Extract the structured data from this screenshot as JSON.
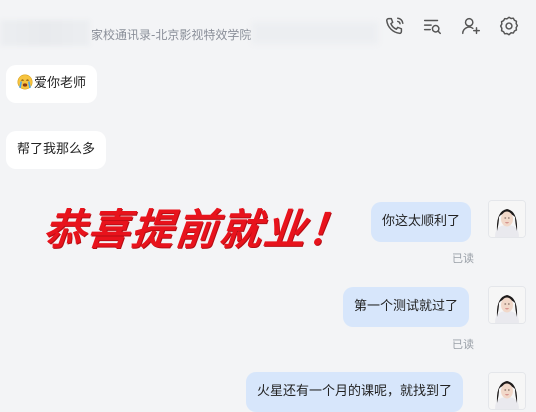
{
  "header": {
    "title": "家校通讯录-北京影视特效学院",
    "icons": [
      "phone-icon",
      "chat-search-icon",
      "add-user-icon",
      "settings-icon"
    ]
  },
  "messages": [
    {
      "side": "left",
      "text": "爱你老师",
      "emoji": "crying-face-icon"
    },
    {
      "side": "left",
      "text": "帮了我那么多"
    },
    {
      "side": "right",
      "text": "你这太顺利了",
      "status": "已读"
    },
    {
      "side": "right",
      "text": "第一个测试就过了",
      "status": "已读"
    },
    {
      "side": "right",
      "text": "火星还有一个月的课呢，就找到了"
    }
  ],
  "overlay": {
    "text": "恭喜提前就业！",
    "color": "#e8131c"
  },
  "colors": {
    "background": "#f3f4f6",
    "bubble_left": "#ffffff",
    "bubble_right": "#d7e6fb",
    "overlay_red": "#e8131c"
  }
}
